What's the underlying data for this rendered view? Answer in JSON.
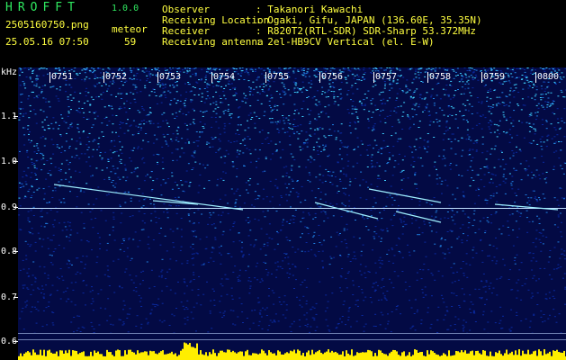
{
  "app": {
    "name": "HROFFT",
    "version": "1.0.0"
  },
  "file": {
    "name": "2505160750.png",
    "datetime": "25.05.16 07:50"
  },
  "meteor": {
    "label": "meteor",
    "count": "59"
  },
  "info": [
    {
      "key": "Observer",
      "value": ": Takanori Kawachi"
    },
    {
      "key": "Receiving Location",
      "value": ": Ogaki, Gifu, JAPAN (136.60E, 35.35N)"
    },
    {
      "key": "Receiver",
      "value": ": R820T2(RTL-SDR) SDR-Sharp 53.372MHz"
    },
    {
      "key": "Receiving antenna",
      "value": ": 2el-HB9CV Vertical (el. E-W)"
    }
  ],
  "axis": {
    "unit": "kHz",
    "yticks": [
      "1.1",
      "1.0",
      "0.9",
      "0.8",
      "0.7",
      "0.6"
    ],
    "xticks": [
      "0751",
      "0752",
      "0753",
      "0754",
      "0755",
      "0756",
      "0757",
      "0758",
      "0759",
      "0800"
    ]
  },
  "colors": {
    "background": "#030a44",
    "noise_low": "#0a2aa0",
    "noise_mid": "#1f7fe0",
    "noise_high": "#3fd0ff",
    "echo": "#9ff0ff",
    "carrier": "#c0e0ff",
    "power": "#ffee00",
    "header_green": "#2fe860",
    "header_yellow": "#ffff40"
  }
}
